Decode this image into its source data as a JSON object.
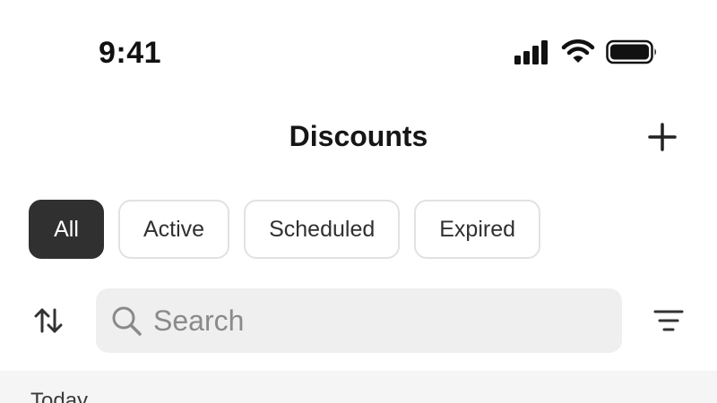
{
  "status_bar": {
    "time": "9:41",
    "icons": [
      "signal-icon",
      "wifi-icon",
      "battery-icon"
    ]
  },
  "header": {
    "title": "Discounts",
    "add_icon": "plus-icon"
  },
  "filters": {
    "chips": [
      {
        "label": "All",
        "selected": true
      },
      {
        "label": "Active",
        "selected": false
      },
      {
        "label": "Scheduled",
        "selected": false
      },
      {
        "label": "Expired",
        "selected": false
      }
    ]
  },
  "search": {
    "placeholder": "Search",
    "value": "",
    "sort_icon": "sort-arrows-icon",
    "filter_icon": "filter-lines-icon"
  },
  "list": {
    "section_label": "Today"
  },
  "colors": {
    "selected_chip_bg": "#303030",
    "search_bg": "#efefef",
    "section_bg": "#f5f5f5"
  }
}
